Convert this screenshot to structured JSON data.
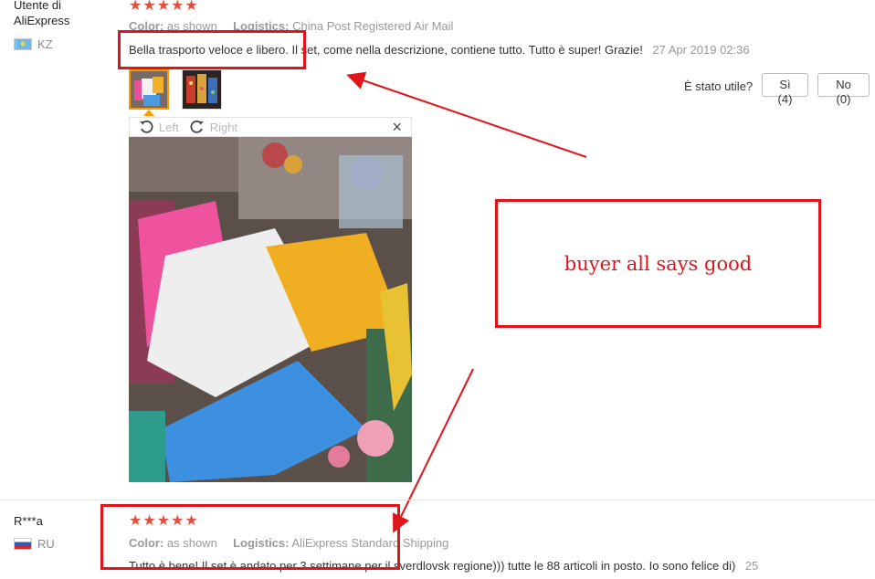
{
  "review1": {
    "user": "Utente di AliExpress",
    "user_line1": "Utente di",
    "user_line2": "AliExpress",
    "country": "KZ",
    "stars": "★★★★★",
    "color_label": "Color:",
    "color_value": "as shown",
    "logistics_label": "Logistics:",
    "logistics_value": "China Post Registered Air Mail",
    "text": "Bella trasporto veloce e libero. Il set, come nella descrizione, contiene tutto. Tutto è super! Grazie!",
    "date": "27 Apr 2019 02:36",
    "helpful_label": "È stato utile?",
    "yes_label": "Sì (4)",
    "no_label": "No (0)",
    "viewer": {
      "rotate_left": "Left",
      "rotate_right": "Right",
      "close": "×"
    }
  },
  "annotation": {
    "note": "buyer all says good"
  },
  "review2": {
    "user": "R***a",
    "country": "RU",
    "stars": "★★★★★",
    "color_label": "Color:",
    "color_value": "as shown",
    "logistics_label": "Logistics:",
    "logistics_value": "AliExpress Standard Shipping",
    "text": "Tutto è bene! Il set è andato per 3 settimane per il sverdlovsk regione))) tutte le 88 articoli in posto. Io sono felice di)",
    "date_partial": "25"
  },
  "colors": {
    "star": "#e74c3c",
    "annotation_red": "#e0141b",
    "active_thumb_border": "#ff9900"
  },
  "icons": [
    "rotate-left-icon",
    "rotate-right-icon",
    "close-icon",
    "kz-flag-icon",
    "ru-flag-icon"
  ]
}
